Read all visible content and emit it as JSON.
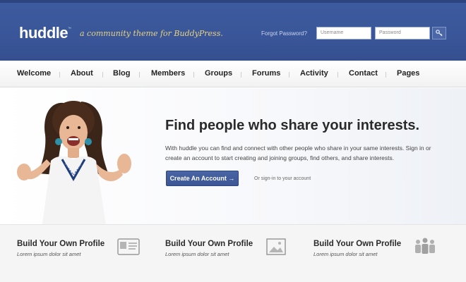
{
  "header": {
    "logo": "huddle",
    "logo_tm": "™",
    "tagline": "a community theme for BuddyPress.",
    "forgot_password": "Forgot Password?",
    "username_placeholder": "Username",
    "password_placeholder": "Password",
    "login_icon": "key-icon"
  },
  "nav": {
    "items": [
      "Welcome",
      "About",
      "Blog",
      "Members",
      "Groups",
      "Forums",
      "Activity",
      "Contact",
      "Pages"
    ]
  },
  "hero": {
    "title": "Find people who share your interests.",
    "text": "With huddle you can find and connect with other people who share in your same interests. Sign in or create an account to start creating and joining groups, find others, and share interests.",
    "cta": "Create An Account →",
    "signin": "Or sign-in to your account"
  },
  "features": [
    {
      "title": "Build Your Own Profile",
      "subtitle": "Lorem ipsum dolor sit amet",
      "icon": "id-card-icon"
    },
    {
      "title": "Build Your Own Profile",
      "subtitle": "Lorem ipsum dolor sit amet",
      "icon": "image-icon"
    },
    {
      "title": "Build Your Own Profile",
      "subtitle": "Lorem ipsum dolor sit amet",
      "icon": "people-icon"
    }
  ],
  "colors": {
    "header_blue": "#3a5699",
    "tagline_gold": "#e9d27a",
    "button_blue": "#4460a0"
  }
}
